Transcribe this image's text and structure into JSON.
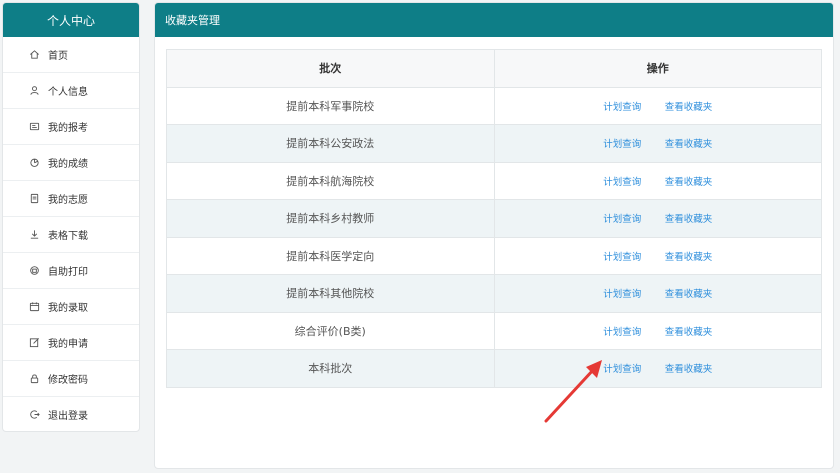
{
  "sidebar": {
    "title": "个人中心",
    "items": [
      {
        "label": "首页",
        "icon": "home-icon"
      },
      {
        "label": "个人信息",
        "icon": "user-icon"
      },
      {
        "label": "我的报考",
        "icon": "id-card-icon"
      },
      {
        "label": "我的成绩",
        "icon": "pie-chart-icon"
      },
      {
        "label": "我的志愿",
        "icon": "document-icon"
      },
      {
        "label": "表格下载",
        "icon": "download-icon"
      },
      {
        "label": "自助打印",
        "icon": "printer-icon"
      },
      {
        "label": "我的录取",
        "icon": "calendar-icon"
      },
      {
        "label": "我的申请",
        "icon": "edit-icon"
      },
      {
        "label": "修改密码",
        "icon": "lock-icon"
      },
      {
        "label": "退出登录",
        "icon": "logout-icon"
      }
    ]
  },
  "main": {
    "title": "收藏夹管理",
    "table": {
      "headers": [
        "批次",
        "操作"
      ],
      "rows": [
        {
          "batch": "提前本科军事院校",
          "action1": "计划查询",
          "action2": "查看收藏夹"
        },
        {
          "batch": "提前本科公安政法",
          "action1": "计划查询",
          "action2": "查看收藏夹"
        },
        {
          "batch": "提前本科航海院校",
          "action1": "计划查询",
          "action2": "查看收藏夹"
        },
        {
          "batch": "提前本科乡村教师",
          "action1": "计划查询",
          "action2": "查看收藏夹"
        },
        {
          "batch": "提前本科医学定向",
          "action1": "计划查询",
          "action2": "查看收藏夹"
        },
        {
          "batch": "提前本科其他院校",
          "action1": "计划查询",
          "action2": "查看收藏夹"
        },
        {
          "batch": "综合评价(B类)",
          "action1": "计划查询",
          "action2": "查看收藏夹"
        },
        {
          "batch": "本科批次",
          "action1": "计划查询",
          "action2": "查看收藏夹"
        }
      ]
    }
  },
  "colors": {
    "header_bg": "#0e7e87",
    "link": "#2f8fdc",
    "arrow": "#e53935",
    "alt_row": "#eef4f6"
  }
}
